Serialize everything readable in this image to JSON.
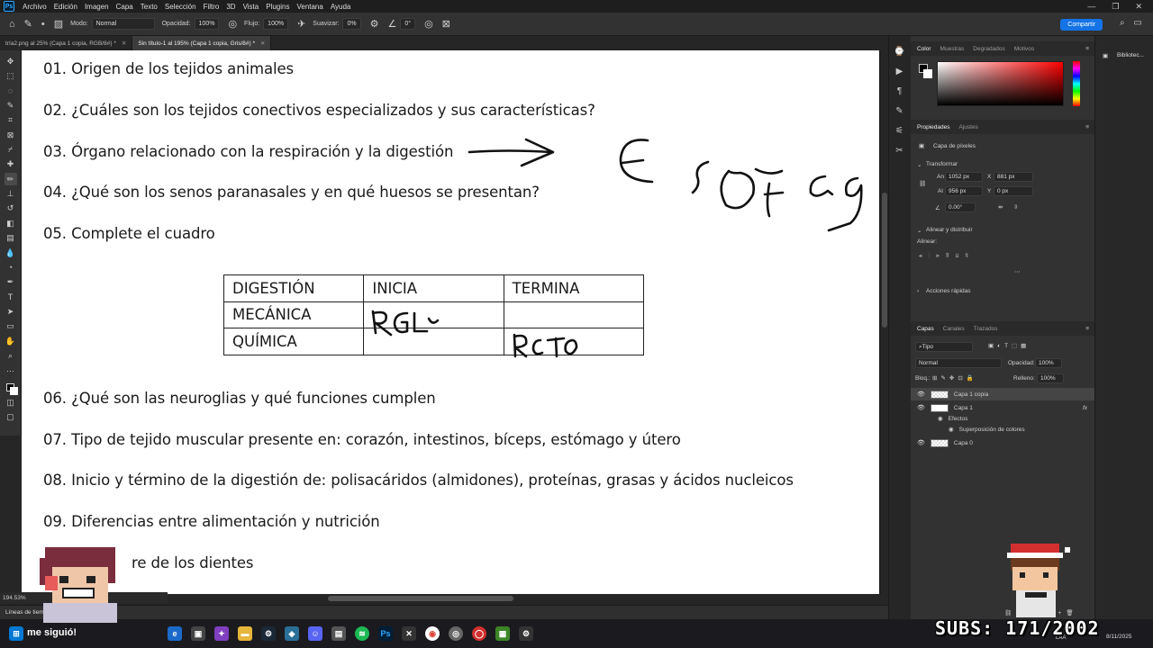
{
  "menubar": {
    "items": [
      "Archivo",
      "Edición",
      "Imagen",
      "Capa",
      "Texto",
      "Selección",
      "Filtro",
      "3D",
      "Vista",
      "Plugins",
      "Ventana",
      "Ayuda"
    ]
  },
  "options": {
    "mode_label": "Modo:",
    "mode_value": "Normal",
    "opacity_label": "Opacidad:",
    "opacity_value": "100%",
    "flow_label": "Flujo:",
    "flow_value": "100%",
    "smoothing_label": "Suavizar:",
    "smoothing_value": "0%",
    "angle_value": "0°",
    "share_label": "Compartir"
  },
  "tabs": [
    {
      "label": "tría2.png al 25% (Capa 1 copia, RGB/8#) *"
    },
    {
      "label": "Sin título-1 al 195% (Capa 1 copia, Gris/8#) *"
    }
  ],
  "document": {
    "questions": [
      "01. Origen de los tejidos animales",
      "02. ¿Cuáles son los tejidos conectivos especializados y sus características?",
      "03. Órgano relacionado con la respiración y la digestión",
      "04. ¿Qué son los senos paranasales y en qué huesos se presentan?",
      "05. Complete el cuadro",
      "06. ¿Qué son las neuroglias y qué funciones cumplen",
      "07. Tipo de tejido muscular presente en: corazón, intestinos, bíceps, estómago y útero",
      "08. Inicio y término de la digestión de: polisacáridos (almidones), proteínas, grasas y ácidos nucleicos",
      "09. Diferencias entre alimentación y nutrición",
      "re de los dientes"
    ],
    "table": {
      "headers": [
        "DIGESTIÓN",
        "INICIA",
        "TERMINA"
      ],
      "rows": [
        [
          "MECÁNICA",
          "",
          ""
        ],
        [
          "QUÍMICA",
          "",
          ""
        ]
      ]
    }
  },
  "status": {
    "zoom": "194.53%",
    "timeline_label": "Líneas de tiempo"
  },
  "panels": {
    "color_tabs": [
      "Color",
      "Muestras",
      "Degradados",
      "Motivos"
    ],
    "prop_tabs": [
      "Propiedades",
      "Ajustes"
    ],
    "pixel_layer": "Capa de píxeles",
    "transform_label": "Transformar",
    "an_label": "An",
    "an_value": "1052 px",
    "x_label": "X",
    "x_value": "881 px",
    "al_label": "Al",
    "al_value": "956 px",
    "y_label": "Y",
    "y_value": "0 px",
    "angle_value": "0.00°",
    "align_label": "Alinear y distribuir",
    "align_sub": "Alinear:",
    "quick_actions": "Acciones rápidas",
    "layer_tabs": [
      "Capas",
      "Canales",
      "Trazados"
    ],
    "kind_filter": "Tipo",
    "blend_mode": "Normal",
    "opacity_label": "Opacidad:",
    "opacity_value": "100%",
    "lock_label": "Bloq.:",
    "fill_label": "Relleno:",
    "fill_value": "100%",
    "layers": [
      "Capa 1 copia",
      "Capa 1",
      "Efectos",
      "Superposición de colores",
      "Capa 0"
    ],
    "library_label": "Bibliotec..."
  },
  "overlay": {
    "notification": "me siguió!",
    "subs": "SUBS: 171/2002",
    "date": "8/11/2025",
    "lang": "LAA"
  }
}
